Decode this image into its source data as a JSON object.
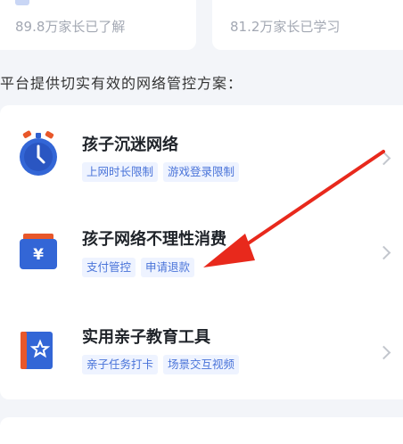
{
  "top_cards": [
    {
      "subtitle": "89.8万家长已了解"
    },
    {
      "subtitle": "81.2万家长已学习"
    }
  ],
  "section_title": "平台提供切实有效的网络管控方案：",
  "solutions": [
    {
      "title": "孩子沉迷网络",
      "icon": "stopwatch-icon",
      "tags": [
        "上网时长限制",
        "游戏登录限制"
      ]
    },
    {
      "title": "孩子网络不理性消费",
      "icon": "yuan-wallet-icon",
      "tags": [
        "支付管控",
        "申请退款"
      ]
    },
    {
      "title": "实用亲子教育工具",
      "icon": "star-book-icon",
      "tags": [
        "亲子任务打卡",
        "场景交互视频"
      ]
    }
  ],
  "colors": {
    "accent": "#3e6fd8",
    "tag_bg": "#eef3ff",
    "tag_text": "#4a74d9",
    "arrow": "#e8291c"
  }
}
